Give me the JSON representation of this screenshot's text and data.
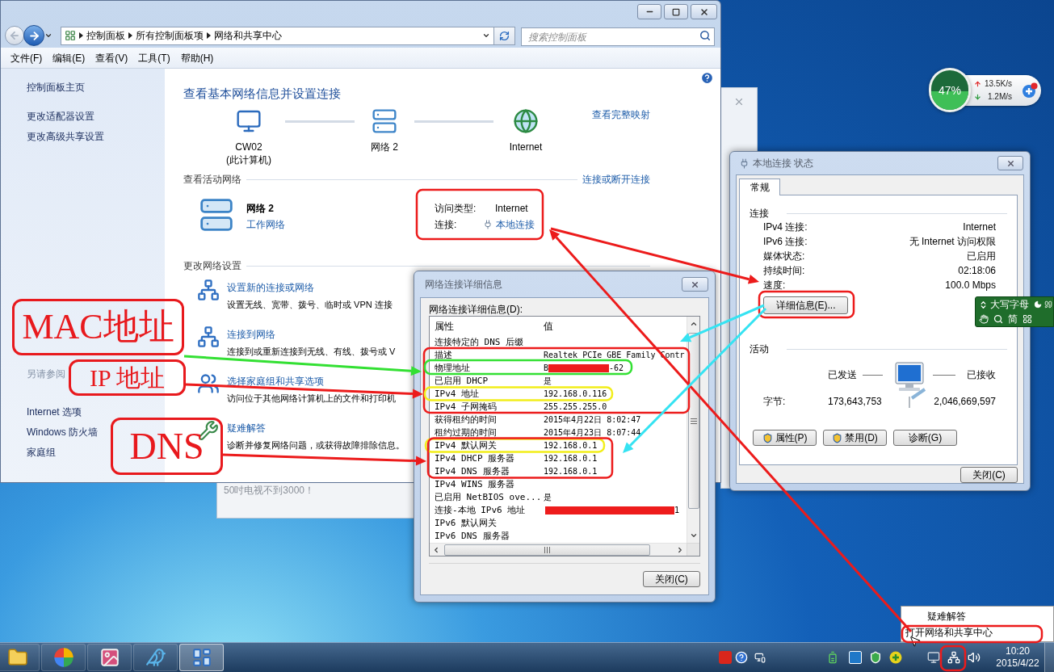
{
  "control_panel": {
    "breadcrumb": [
      "控制面板",
      "所有控制面板项",
      "网络和共享中心"
    ],
    "search": {
      "placeholder": "搜索控制面板"
    },
    "menu": [
      "文件(F)",
      "编辑(E)",
      "查看(V)",
      "工具(T)",
      "帮助(H)"
    ],
    "sidebar": {
      "links": [
        "控制面板主页",
        "更改适配器设置",
        "更改高级共享设置"
      ],
      "see_also_heading": "另请参阅",
      "see_also": [
        "Internet 选项",
        "Windows 防火墙",
        "家庭组"
      ]
    },
    "title": "查看基本网络信息并设置连接",
    "map": {
      "nodes": [
        {
          "kind": "computer",
          "label": "CW02",
          "sublabel": "(此计算机)"
        },
        {
          "kind": "network",
          "label": "网络 2"
        },
        {
          "kind": "internet",
          "label": "Internet"
        }
      ],
      "link": "查看完整映射"
    },
    "active_networks": {
      "heading": "查看活动网络",
      "link": "连接或断开连接",
      "name": "网络 2",
      "type": "工作网络",
      "access_label": "访问类型:",
      "access_value": "Internet",
      "connection_label": "连接:",
      "connection_value": "本地连接"
    },
    "change_settings": {
      "heading": "更改网络设置",
      "tasks": [
        {
          "kind": "new",
          "title": "设置新的连接或网络",
          "description": "设置无线、宽带、拨号、临时或 VPN 连接"
        },
        {
          "kind": "connect",
          "title": "连接到网络",
          "description": "连接到或重新连接到无线、有线、拨号或 V"
        },
        {
          "kind": "homegroup",
          "title": "选择家庭组和共享选项",
          "description": "访问位于其他网络计算机上的文件和打印机"
        },
        {
          "kind": "troubleshoot",
          "title": "疑难解答",
          "description": "诊断并修复网络问题，或获得故障排除信息。"
        }
      ]
    }
  },
  "background_window": {
    "text": "50吋电视不到3000！"
  },
  "details_dialog": {
    "title": "网络连接详细信息",
    "label": "网络连接详细信息(D):",
    "columns": [
      "属性",
      "值"
    ],
    "rows": [
      {
        "kind": "text",
        "property": "连接特定的 DNS 后缀"
      },
      {
        "kind": "text",
        "property": "描述",
        "value": "Realtek PCIe GBE Family Contr"
      },
      {
        "kind": "redacted",
        "property": "物理地址",
        "value": "B",
        "value_end": "-62"
      },
      {
        "kind": "text",
        "property": "已启用 DHCP",
        "value": "是"
      },
      {
        "kind": "text",
        "property": "IPv4 地址",
        "value": "192.168.0.116"
      },
      {
        "kind": "text",
        "property": "IPv4 子网掩码",
        "value": "255.255.255.0"
      },
      {
        "kind": "text",
        "property": "获得租约的时间",
        "value": "2015年4月22日 8:02:47"
      },
      {
        "kind": "text",
        "property": "租约过期的时间",
        "value": "2015年4月23日 8:07:44"
      },
      {
        "kind": "text",
        "property": "IPv4 默认网关",
        "value": "192.168.0.1"
      },
      {
        "kind": "text",
        "property": "IPv4 DHCP 服务器",
        "value": "192.168.0.1"
      },
      {
        "kind": "text",
        "property": "IPv4 DNS 服务器",
        "value": "192.168.0.1"
      },
      {
        "kind": "text",
        "property": "IPv4 WINS 服务器"
      },
      {
        "kind": "text",
        "property": "已启用 NetBIOS ove...",
        "value": "是"
      },
      {
        "kind": "redacted",
        "property": "连接-本地 IPv6 地址",
        "value_end": "1"
      },
      {
        "kind": "text",
        "property": "IPv6 默认网关"
      },
      {
        "kind": "text",
        "property": "IPv6 DNS 服务器"
      }
    ],
    "close": "关闭(C)"
  },
  "status_dialog": {
    "title": "本地连接 状态",
    "tabs": [
      {
        "label": "常规",
        "selected": true
      }
    ],
    "connection": {
      "heading": "连接",
      "rows": [
        {
          "label": "IPv4 连接:",
          "value": "Internet"
        },
        {
          "label": "IPv6 连接:",
          "value": "无 Internet 访问权限"
        },
        {
          "label": "媒体状态:",
          "value": "已启用"
        },
        {
          "label": "持续时间:",
          "value": "02:18:06"
        },
        {
          "label": "速度:",
          "value": "100.0 Mbps"
        }
      ]
    },
    "details_button": "详细信息(E)...",
    "activity": {
      "heading": "活动",
      "sent_label": "已发送",
      "received_label": "已接收",
      "bytes_label": "字节:",
      "sent": "173,643,753",
      "received": "2,046,669,597"
    },
    "buttons": [
      {
        "label": "属性(P)",
        "kind": "shield"
      },
      {
        "label": "禁用(D)",
        "kind": "shield"
      },
      {
        "label": "诊断(G)",
        "kind": "plain"
      }
    ],
    "close": "关闭(C)"
  },
  "gadget": {
    "reading": "47%",
    "level": 0.47,
    "upload": "13.5K/s",
    "download": "1.2M/s"
  },
  "ime_bar": {
    "caps": "大写字母",
    "mode": "简"
  },
  "tray_menu": {
    "items": [
      "疑难解答",
      "打开网络和共享中心"
    ]
  },
  "taskbar": {
    "apps": [
      {
        "kind": "folder",
        "selected": false
      },
      {
        "kind": "color-wheel",
        "selected": false
      },
      {
        "kind": "picture",
        "selected": false
      },
      {
        "kind": "bird",
        "selected": false
      },
      {
        "kind": "control-panel",
        "selected": true
      }
    ],
    "clock": {
      "time": "10:20",
      "date": "2015/4/22"
    }
  },
  "annotations": {
    "callouts": [
      "MAC地址",
      "IP 地址",
      "DNS"
    ]
  }
}
